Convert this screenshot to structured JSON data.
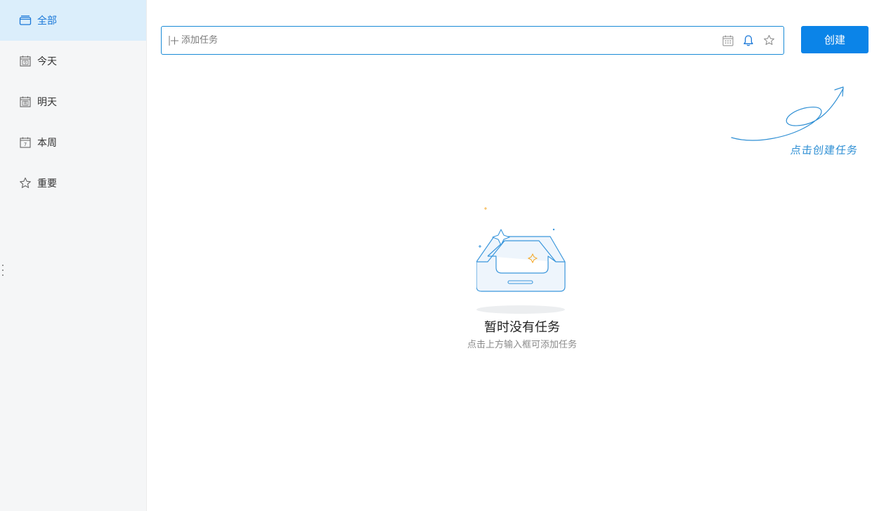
{
  "sidebar": {
    "items": [
      {
        "label": "全部",
        "icon": "all-list-icon",
        "active": true
      },
      {
        "label": "今天",
        "icon": "today-calendar-icon",
        "active": false
      },
      {
        "label": "明天",
        "icon": "tomorrow-calendar-icon",
        "active": false
      },
      {
        "label": "本周",
        "icon": "week-calendar-icon",
        "active": false
      },
      {
        "label": "重要",
        "icon": "star-icon",
        "active": false
      }
    ]
  },
  "task_input": {
    "placeholder": "添加任务",
    "tools": [
      "calendar-icon",
      "bell-icon",
      "star-icon"
    ]
  },
  "create_button": {
    "label": "创建"
  },
  "hint": {
    "text": "点击创建任务"
  },
  "empty_state": {
    "title": "暂时没有任务",
    "subtitle": "点击上方输入框可添加任务"
  },
  "colors": {
    "accent": "#0b84e8",
    "active_bg": "#dbeefb",
    "sidebar_bg": "#f5f6f7"
  }
}
